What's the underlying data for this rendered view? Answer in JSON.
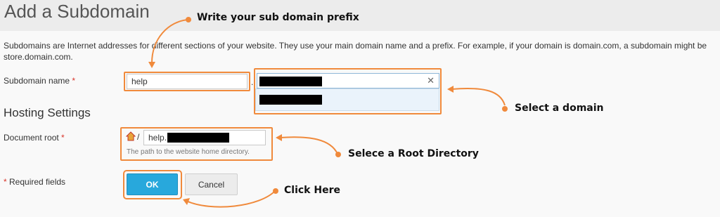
{
  "page": {
    "title": "Add a Subdomain",
    "description": "Subdomains are Internet addresses for different sections of your website. They use your main domain name and a prefix. For example, if your domain is domain.com, a subdomain might be store.domain.com."
  },
  "form": {
    "subdomain_label": "Subdomain name",
    "required_star": "*",
    "subdomain_value": "help",
    "separator": ".",
    "hosting_settings_title": "Hosting Settings",
    "document_root_label": "Document root",
    "home_slash": "/",
    "document_root_prefix": "help.",
    "document_root_hint": "The path to the website home directory.",
    "required_fields_label": "Required fields",
    "clear_glyph": "✕"
  },
  "buttons": {
    "ok": "OK",
    "cancel": "Cancel"
  },
  "annotations": {
    "prefix": "Write your sub domain prefix",
    "domain": "Select a domain",
    "root": "Selece a Root Directory",
    "click": "Click Here"
  },
  "colors": {
    "accent_orange": "#f08a3c",
    "ok_blue": "#28a8dc"
  },
  "icons": {
    "home": "home-icon",
    "clear": "close-icon"
  }
}
